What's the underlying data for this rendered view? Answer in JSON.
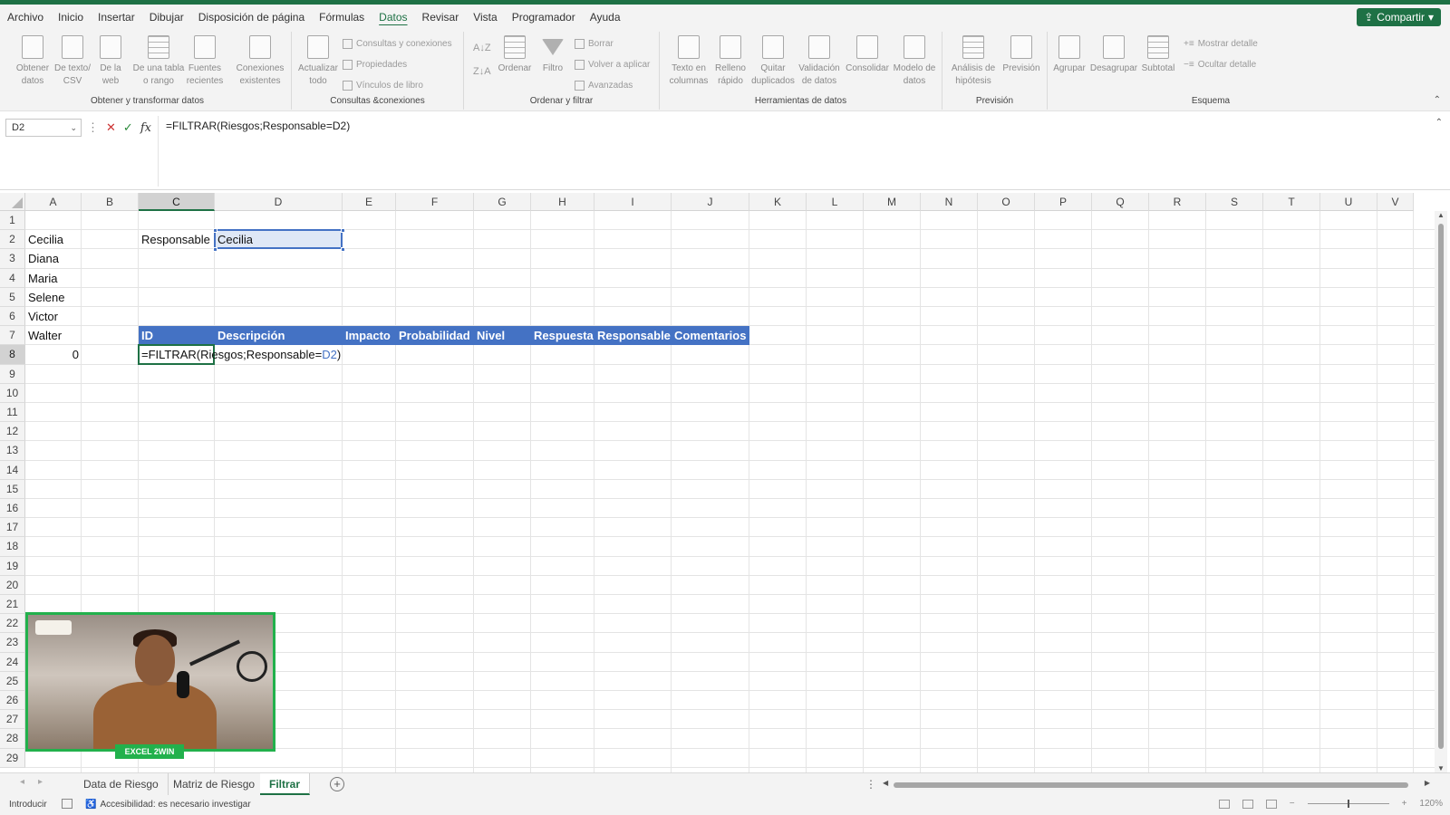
{
  "menu": {
    "items": [
      "Archivo",
      "Inicio",
      "Insertar",
      "Dibujar",
      "Disposición de página",
      "Fórmulas",
      "Datos",
      "Revisar",
      "Vista",
      "Programador",
      "Ayuda"
    ],
    "active": "Datos",
    "share_label": "Compartir"
  },
  "ribbon": {
    "groups": {
      "get_data": "Obtener y transformar datos",
      "queries": "Consultas &conexiones",
      "sort_filter": "Ordenar y filtrar",
      "data_tools": "Herramientas de datos",
      "forecast": "Previsión",
      "outline": "Esquema"
    },
    "buttons": {
      "obtener": [
        "Obtener",
        "datos"
      ],
      "texto_csv": [
        "De texto/",
        "CSV"
      ],
      "web": [
        "De la",
        "web"
      ],
      "tabla": [
        "De una tabla",
        "o rango"
      ],
      "fuentes": [
        "Fuentes",
        "recientes"
      ],
      "conexiones": [
        "Conexiones",
        "existentes"
      ],
      "actualizar": [
        "Actualizar",
        "todo"
      ],
      "ordenar": "Ordenar",
      "filtro": "Filtro",
      "texto_col": [
        "Texto en",
        "columnas"
      ],
      "relleno": [
        "Relleno",
        "rápido"
      ],
      "quitar": [
        "Quitar",
        "duplicados"
      ],
      "validacion": [
        "Validación",
        "de datos"
      ],
      "consolidar": "Consolidar",
      "modelo": [
        "Modelo de",
        "datos"
      ],
      "analisis": [
        "Análisis de",
        "hipótesis"
      ],
      "prevision": "Previsión",
      "agrupar": "Agrupar",
      "desagrupar": "Desagrupar",
      "subtotal": "Subtotal"
    },
    "small": {
      "consultas": "Consultas y conexiones",
      "propiedades": "Propiedades",
      "vinculos": "Vínculos de libro",
      "borrar": "Borrar",
      "volver": "Volver a aplicar",
      "avanzadas": "Avanzadas",
      "mostrar": "Mostrar detalle",
      "ocultar": "Ocultar detalle"
    }
  },
  "formula_bar": {
    "name_box": "D2",
    "fx": "fx",
    "formula": "=FILTRAR(Riesgos;Responsable=D2)"
  },
  "grid": {
    "columns": [
      "A",
      "B",
      "C",
      "D",
      "E",
      "F",
      "G",
      "H",
      "I",
      "J",
      "K",
      "L",
      "M",
      "N",
      "O",
      "P",
      "Q",
      "R",
      "S",
      "T",
      "U",
      "V"
    ],
    "rows": [
      "1",
      "2",
      "3",
      "4",
      "5",
      "6",
      "7",
      "8",
      "9",
      "10",
      "11",
      "12",
      "13",
      "14",
      "15",
      "16",
      "17",
      "18",
      "19",
      "20",
      "21",
      "22",
      "23",
      "24",
      "25",
      "26",
      "27",
      "28",
      "29"
    ],
    "colA": [
      "",
      "Cecilia",
      "Diana",
      "Maria",
      "Selene",
      "Victor",
      "Walter",
      "0"
    ],
    "c2": "Responsable",
    "d2": "Cecilia",
    "table_headers": [
      "ID",
      "Descripción",
      "Impacto",
      "Probabilidad",
      "Nivel",
      "Respuesta",
      "Responsable",
      "Comentarios"
    ],
    "editing": {
      "prefix": "=FILTRAR(Riesgos;Responsable=",
      "ref": "D2",
      "suffix": ")"
    }
  },
  "webcam_badge": "EXCEL 2WIN",
  "sheets": {
    "tabs": [
      "Data de Riesgo",
      "Matriz de Riesgo",
      "Filtrar"
    ],
    "active": "Filtrar"
  },
  "status": {
    "mode": "Introducir",
    "accessibility": "Accesibilidad: es necesario investigar",
    "zoom": "120%"
  }
}
